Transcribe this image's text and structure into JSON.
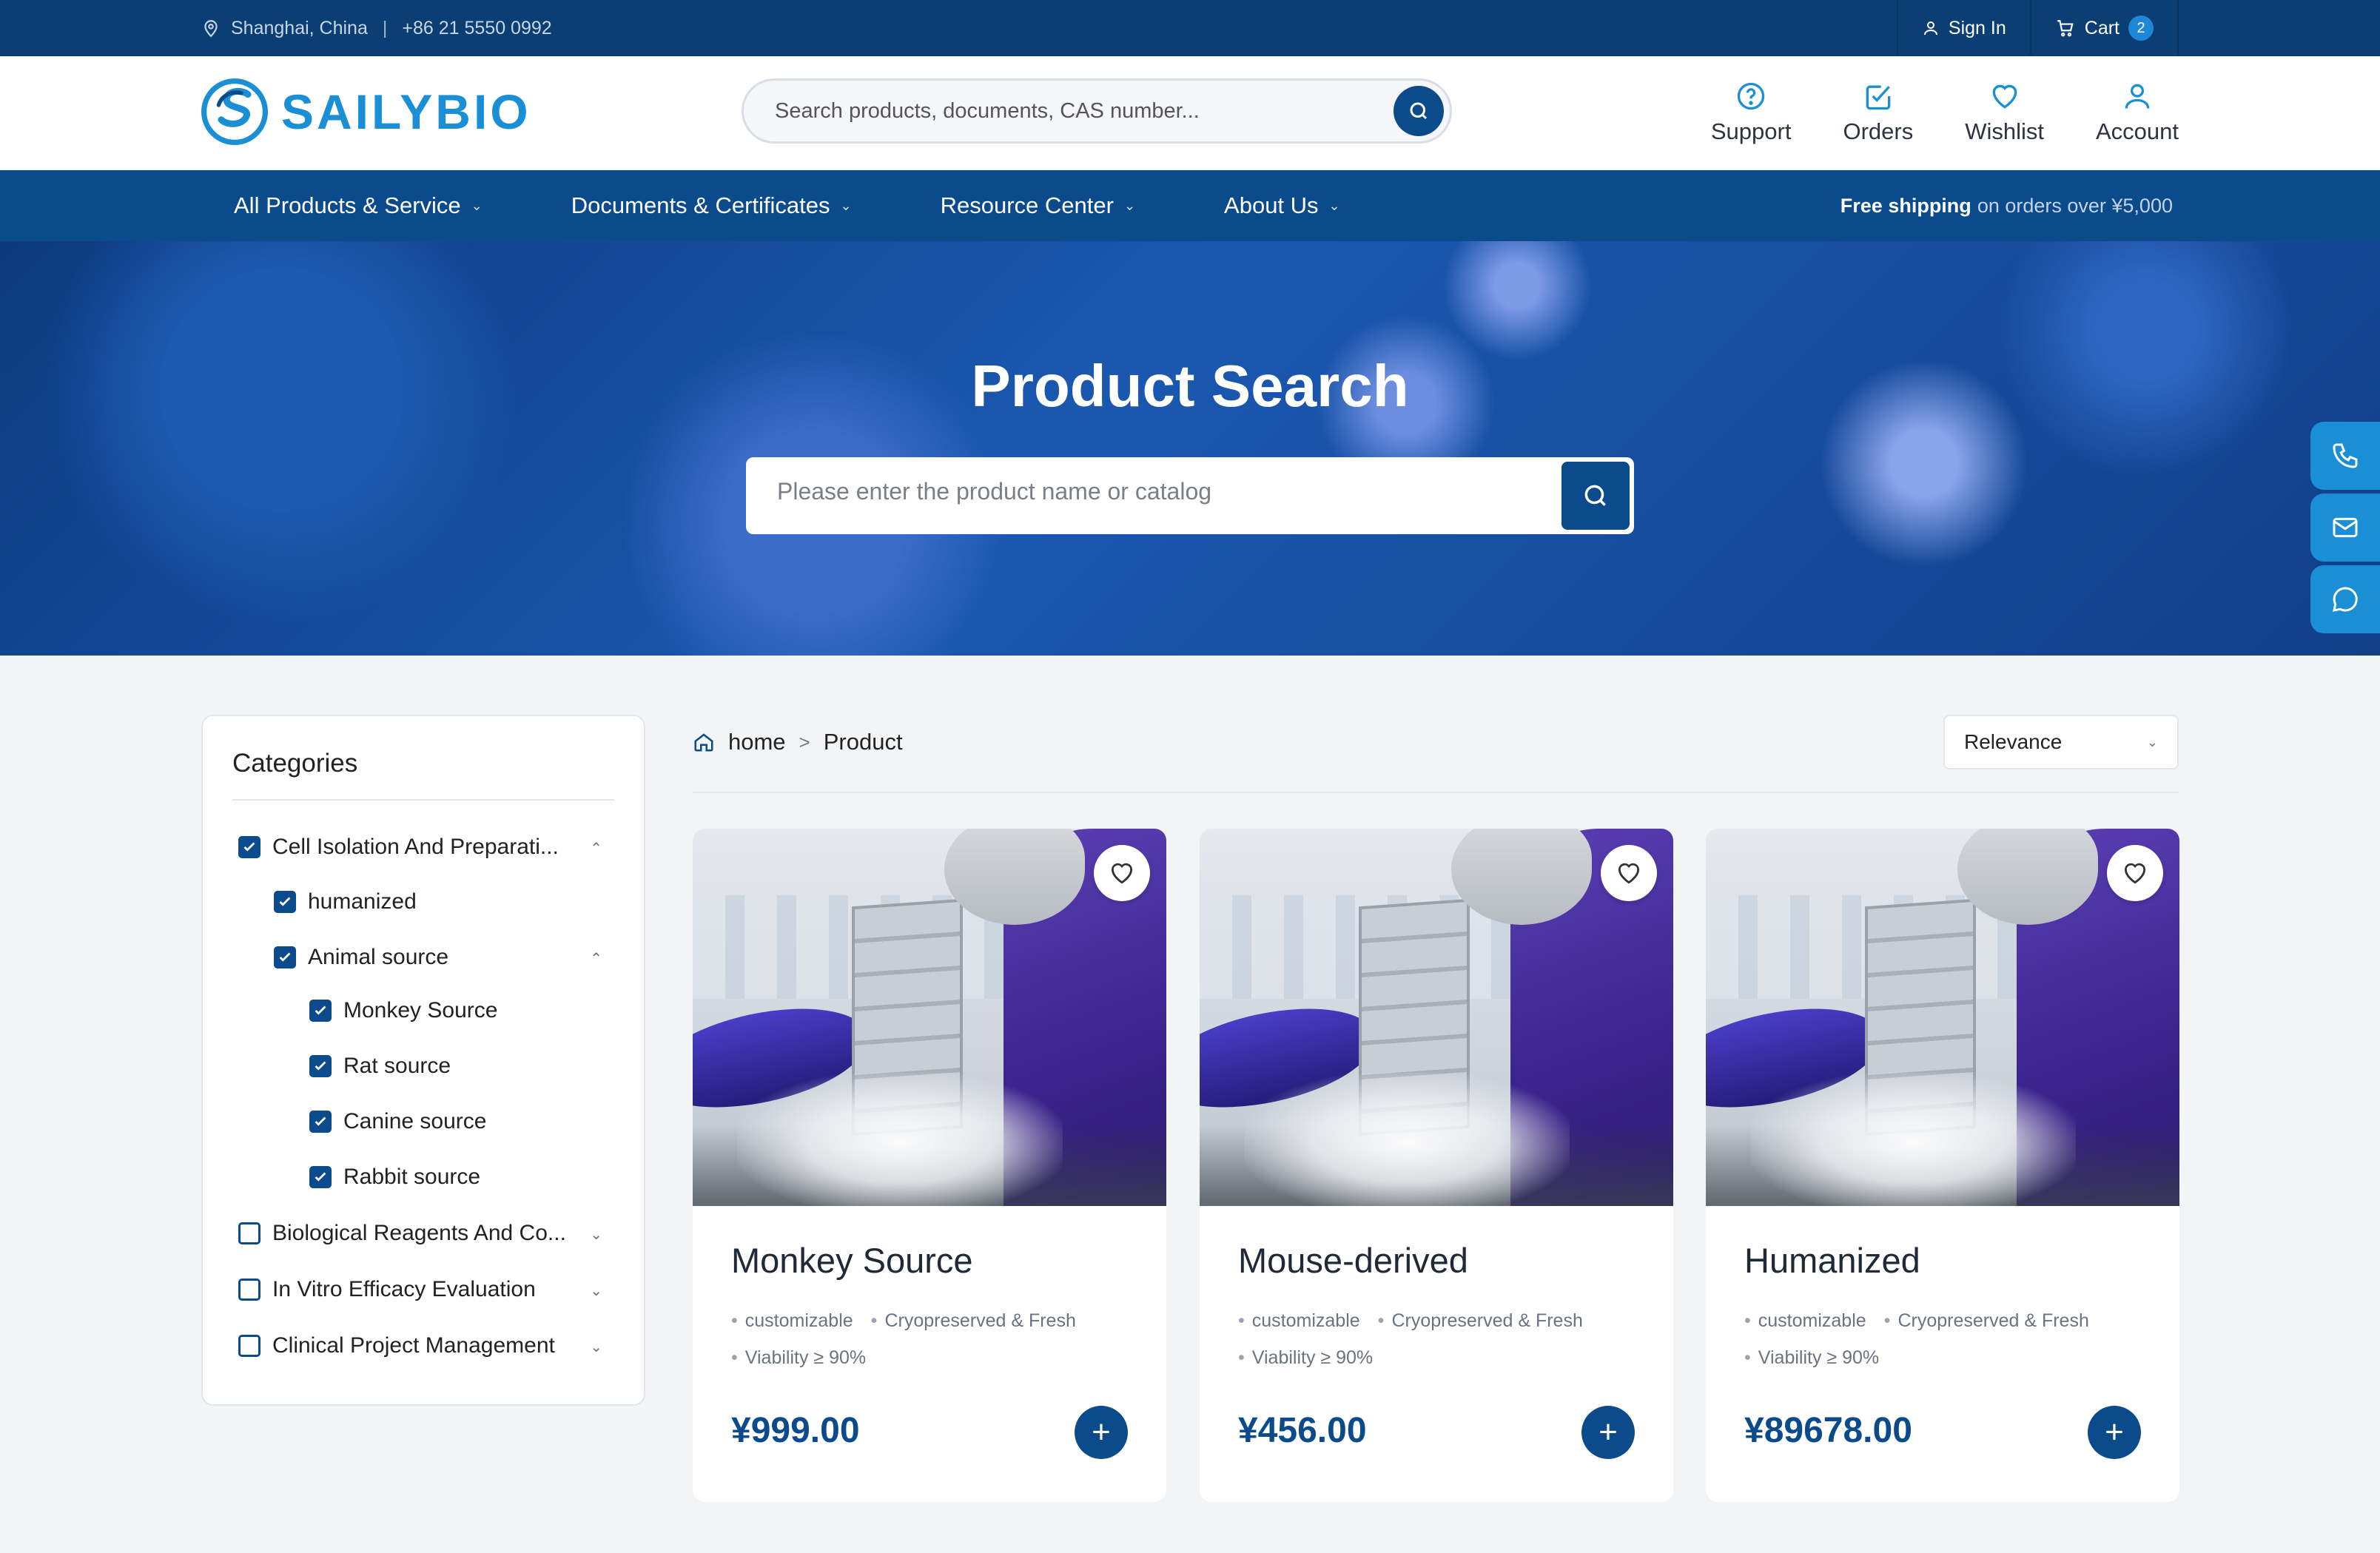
{
  "topbar": {
    "location": "Shanghai, China",
    "separator": "|",
    "phone": "+86 21 5550 0992",
    "sign_in": "Sign In",
    "cart": "Cart",
    "cart_count": "2"
  },
  "header": {
    "logo": "SAILYBIO",
    "search_placeholder": "Search products, documents, CAS number...",
    "nav": [
      {
        "label": "Support",
        "icon": "help-circle-icon"
      },
      {
        "label": "Orders",
        "icon": "checklist-icon"
      },
      {
        "label": "Wishlist",
        "icon": "heart-icon"
      },
      {
        "label": "Account",
        "icon": "user-icon"
      }
    ]
  },
  "mainnav": {
    "items": [
      {
        "label": "All Products & Service"
      },
      {
        "label": "Documents & Certificates"
      },
      {
        "label": "Resource Center"
      },
      {
        "label": "About Us"
      }
    ],
    "shipping_bold": "Free shipping",
    "shipping_rest": "on orders over ¥5,000"
  },
  "hero": {
    "title": "Product Search",
    "search_placeholder": "Please enter the product name or catalog"
  },
  "floating": [
    "phone-icon",
    "mail-icon",
    "chat-icon"
  ],
  "sidebar": {
    "title": "Categories",
    "items": [
      {
        "label": "Cell Isolation And Preparati...",
        "checked": true,
        "level": 0,
        "expanded": true
      },
      {
        "label": "humanized",
        "checked": true,
        "level": 1
      },
      {
        "label": "Animal source",
        "checked": true,
        "level": 1,
        "expanded": true
      },
      {
        "label": "Monkey Source",
        "checked": true,
        "level": 2
      },
      {
        "label": "Rat source",
        "checked": true,
        "level": 2
      },
      {
        "label": "Canine source",
        "checked": true,
        "level": 2
      },
      {
        "label": "Rabbit source",
        "checked": true,
        "level": 2
      },
      {
        "label": "Biological Reagents And Co...",
        "checked": false,
        "level": 0,
        "expanded": false
      },
      {
        "label": "In Vitro Efficacy Evaluation",
        "checked": false,
        "level": 0,
        "expanded": false
      },
      {
        "label": "Clinical Project Management",
        "checked": false,
        "level": 0,
        "expanded": false
      }
    ]
  },
  "breadcrumb": {
    "home": "home",
    "separator": ">",
    "current": "Product"
  },
  "sort": {
    "selected": "Relevance"
  },
  "products": [
    {
      "title": "Monkey Source",
      "tags": [
        "customizable",
        "Cryopreserved & Fresh",
        "Viability ≥ 90%"
      ],
      "price": "¥999.00"
    },
    {
      "title": "Mouse-derived",
      "tags": [
        "customizable",
        "Cryopreserved & Fresh",
        "Viability ≥ 90%"
      ],
      "price": "¥456.00"
    },
    {
      "title": "Humanized",
      "tags": [
        "customizable",
        "Cryopreserved & Fresh",
        "Viability ≥ 90%"
      ],
      "price": "¥89678.00"
    }
  ],
  "colors": {
    "primary": "#0b4a8b",
    "topbar": "#0b3f73",
    "accent": "#1a8fd6",
    "background": "#f3f4f6"
  }
}
